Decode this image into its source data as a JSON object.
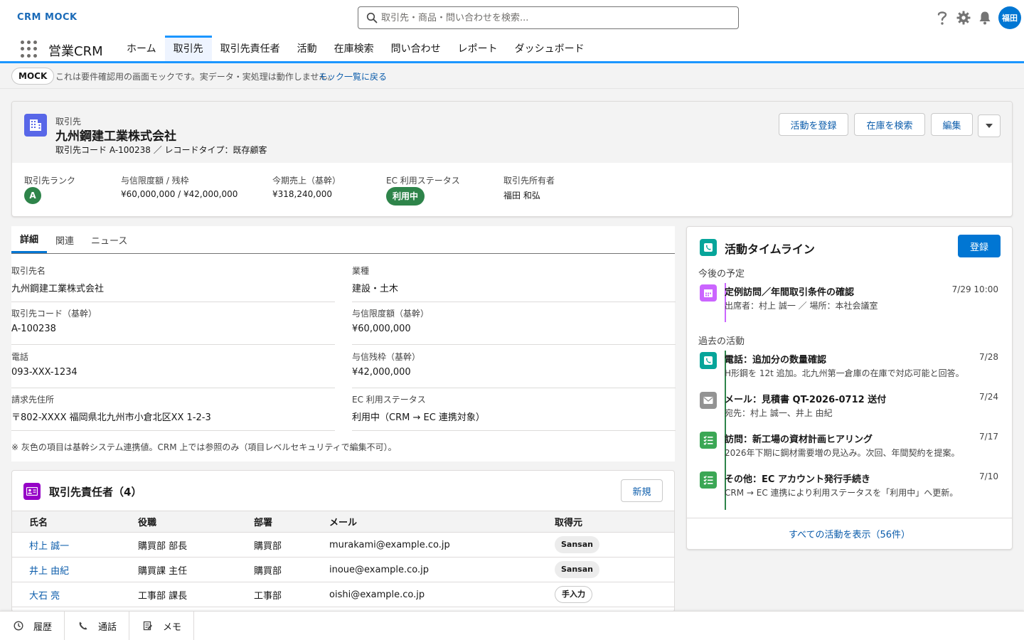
{
  "brand": "CRM MOCK",
  "search": {
    "placeholder": "取引先・商品・問い合わせを検索..."
  },
  "user": {
    "avatar": "福田"
  },
  "app": {
    "name": "営業CRM",
    "tabs": [
      "ホーム",
      "取引先",
      "取引先責任者",
      "活動",
      "在庫検索",
      "問い合わせ",
      "レポート",
      "ダッシュボード"
    ],
    "active_tab": "取引先"
  },
  "mock_banner": {
    "badge": "MOCK",
    "text": "これは要件確認用の画面モックです。実データ・実処理は動作しません。",
    "link": "モック一覧に戻る"
  },
  "record": {
    "object_label": "取引先",
    "title": "九州鋼建工業株式会社",
    "subtitle": "取引先コード A-100238 ／ レコードタイプ：既存顧客",
    "actions": [
      "活動を登録",
      "在庫を検索",
      "編集"
    ],
    "highlights": [
      {
        "label": "取引先ランク",
        "value": "A"
      },
      {
        "label": "与信限度額 / 残枠",
        "value": "¥60,000,000 / ¥42,000,000"
      },
      {
        "label": "今期売上（基幹）",
        "value": "¥318,240,000"
      },
      {
        "label": "EC 利用ステータス",
        "value": "利用中"
      },
      {
        "label": "取引先所有者",
        "value": "福田 和弘"
      }
    ]
  },
  "detail": {
    "tabs": [
      "詳細",
      "関連",
      "ニュース"
    ],
    "active_tab": "詳細",
    "fields": [
      {
        "label": "取引先名",
        "value": "九州鋼建工業株式会社"
      },
      {
        "label": "業種",
        "value": "建設・土木"
      },
      {
        "label": "取引先コード（基幹）",
        "value": "A-100238"
      },
      {
        "label": "与信限度額（基幹）",
        "value": "¥60,000,000"
      },
      {
        "label": "電話",
        "value": "093-XXX-1234"
      },
      {
        "label": "与信残枠（基幹）",
        "value": "¥42,000,000"
      },
      {
        "label": "請求先住所",
        "value": "〒802-XXXX 福岡県北九州市小倉北区XX 1-2-3"
      },
      {
        "label": "EC 利用ステータス",
        "value": "利用中（CRM → EC 連携対象）"
      }
    ],
    "note": "※ 灰色の項目は基幹システム連携値。CRM 上では参照のみ（項目レベルセキュリティで編集不可）。"
  },
  "contacts": {
    "title": "取引先責任者（4）",
    "new_button": "新規",
    "columns": [
      "氏名",
      "役職",
      "部署",
      "メール",
      "取得元"
    ],
    "rows": [
      {
        "name": "村上 誠一",
        "title": "購買部 部長",
        "dept": "購買部",
        "email": "murakami@example.co.jp",
        "source": "Sansan"
      },
      {
        "name": "井上 由紀",
        "title": "購買課 主任",
        "dept": "購買部",
        "email": "inoue@example.co.jp",
        "source": "Sansan"
      },
      {
        "name": "大石 亮",
        "title": "工事部 課長",
        "dept": "工事部",
        "email": "oishi@example.co.jp",
        "source": "手入力"
      }
    ]
  },
  "timeline": {
    "title": "活動タイムライン",
    "register_button": "登録",
    "upcoming_label": "今後の予定",
    "upcoming": [
      {
        "icon": "calendar-icon",
        "title": "定例訪問／年間取引条件の確認",
        "date": "7/29 10:00",
        "desc": "出席者：村上 誠一 ／ 場所：本社会議室"
      }
    ],
    "past_label": "過去の活動",
    "past": [
      {
        "icon": "phone-icon",
        "title": "電話：追加分の数量確認",
        "date": "7/28",
        "desc": "H形鋼を 12t 追加。北九州第一倉庫の在庫で対応可能と回答。"
      },
      {
        "icon": "email-icon",
        "title": "メール：見積書 QT-2026-0712 送付",
        "date": "7/24",
        "desc": "宛先：村上 誠一、井上 由紀"
      },
      {
        "icon": "task-icon",
        "title": "訪問：新工場の資材計画ヒアリング",
        "date": "7/17",
        "desc": "2026年下期に鋼材需要増の見込み。次回、年間契約を提案。"
      },
      {
        "icon": "task-icon",
        "title": "その他：EC アカウント発行手続き",
        "date": "7/10",
        "desc": "CRM → EC 連携により利用ステータスを「利用中」へ更新。"
      }
    ],
    "footer_link": "すべての活動を表示（56件）"
  },
  "utility_bar": [
    "履歴",
    "通話",
    "メモ"
  ],
  "colors": {
    "brand_blue": "#0176d3",
    "nav_accent": "#1b96ff",
    "account_icon": "#5867e8",
    "contact_icon": "#9602c7",
    "timeline_icon": "#06a59a",
    "status_green": "#2e844a",
    "event_purple": "#cb65ff",
    "email_gray": "#939393",
    "task_green": "#3ba755"
  }
}
